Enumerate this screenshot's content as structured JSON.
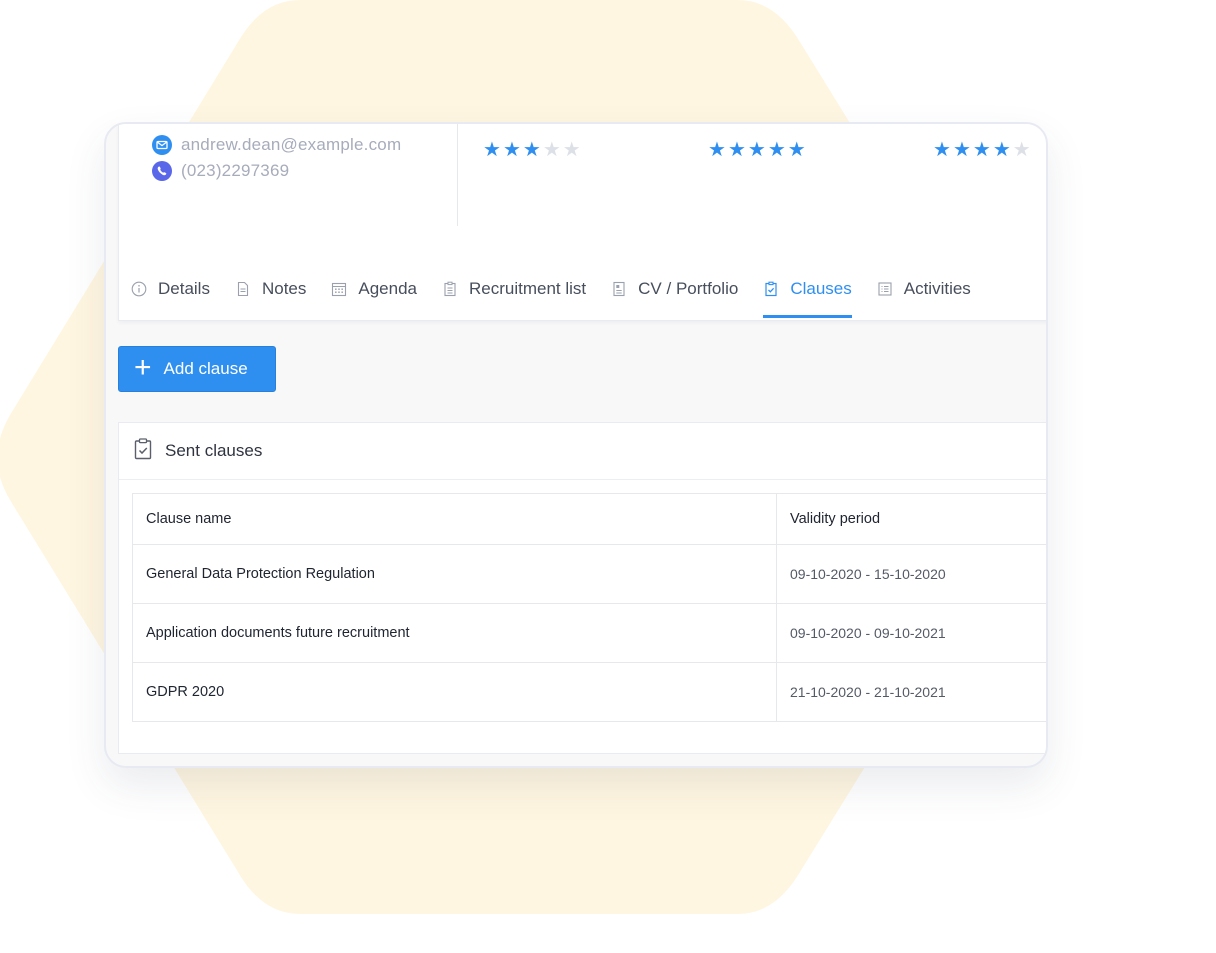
{
  "colors": {
    "accent": "#2f8ff0",
    "hexagon": "#fff6e1",
    "star_off": "#dde1e7",
    "whatsapp": "#5a67e8"
  },
  "contact": {
    "email": "andrew.dean@example.com",
    "phone": "(023)2297369",
    "email_icon": "envelope-icon",
    "phone_icon": "whatsapp-icon"
  },
  "ratings": [
    {
      "value": 3,
      "max": 5
    },
    {
      "value": 5,
      "max": 5
    },
    {
      "value": 4,
      "max": 5
    }
  ],
  "tabs": [
    {
      "label": "Details",
      "icon": "info-icon",
      "active": false
    },
    {
      "label": "Notes",
      "icon": "document-icon",
      "active": false
    },
    {
      "label": "Agenda",
      "icon": "calendar-icon",
      "active": false
    },
    {
      "label": "Recruitment list",
      "icon": "clipboard-icon",
      "active": false
    },
    {
      "label": "CV / Portfolio",
      "icon": "file-icon",
      "active": false
    },
    {
      "label": "Clauses",
      "icon": "clipboard-check-icon",
      "active": true
    },
    {
      "label": "Activities",
      "icon": "list-icon",
      "active": false
    }
  ],
  "add_button": {
    "label": "Add clause",
    "icon": "plus-icon"
  },
  "sent_clauses": {
    "title": "Sent clauses",
    "icon": "clipboard-check-icon",
    "columns": [
      "Clause name",
      "Validity period"
    ],
    "rows": [
      {
        "name": "General Data Protection Regulation",
        "period": "09-10-2020 - 15-10-2020"
      },
      {
        "name": "Application documents future recruitment",
        "period": "09-10-2020 - 09-10-2021"
      },
      {
        "name": "GDPR 2020",
        "period": "21-10-2020 - 21-10-2021"
      }
    ]
  }
}
